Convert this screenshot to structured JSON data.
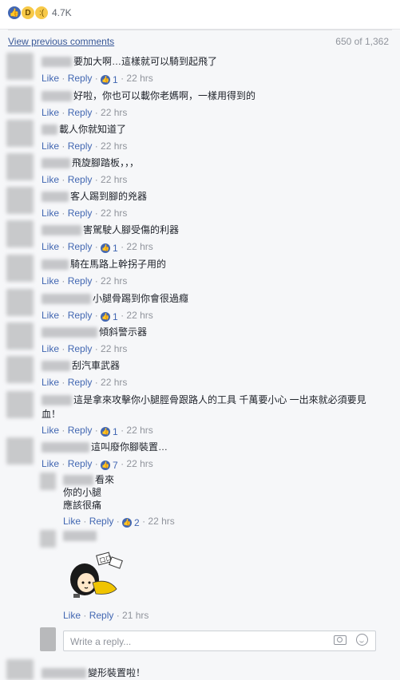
{
  "reactions": {
    "count": "4.7K"
  },
  "comments_header": {
    "view_previous": "View previous comments",
    "counter": "650 of 1,362"
  },
  "actions": {
    "like": "Like",
    "reply": "Reply"
  },
  "comments": [
    {
      "text": "要加大啊…這樣就可以騎到起飛了",
      "likes": "1",
      "time": "22 hrs"
    },
    {
      "text": "好啦，你也可以載你老媽啊，一樣用得到的",
      "likes": "",
      "time": "22 hrs"
    },
    {
      "text": "載人你就知道了",
      "likes": "",
      "time": "22 hrs"
    },
    {
      "text": "飛旋腳踏板，，，",
      "likes": "",
      "time": "22 hrs"
    },
    {
      "text": "客人踢到腳的兇器",
      "likes": "",
      "time": "22 hrs"
    },
    {
      "text": "害駕駛人腳受傷的利器",
      "likes": "1",
      "time": "22 hrs"
    },
    {
      "text": "騎在馬路上幹拐子用的",
      "likes": "",
      "time": "22 hrs"
    },
    {
      "text": "小腿骨踢到你會很過癮",
      "likes": "1",
      "time": "22 hrs"
    },
    {
      "text": "傾斜警示器",
      "likes": "",
      "time": "22 hrs"
    },
    {
      "text": "刮汽車武器",
      "likes": "",
      "time": "22 hrs"
    },
    {
      "text": "這是拿來攻擊你小腿脛骨跟路人的工具 千萬要小心 一出來就必須要見",
      "text2": "血！",
      "likes": "1",
      "time": "22 hrs"
    },
    {
      "text": "這叫廢你腳裝置…",
      "likes": "7",
      "time": "22 hrs"
    }
  ],
  "replies": [
    {
      "line1": "看來",
      "line2": "你的小腿",
      "line3": "應該很痛",
      "likes": "2",
      "time": "22 hrs"
    },
    {
      "time": "21 hrs"
    }
  ],
  "reply_input": {
    "placeholder": "Write a reply..."
  },
  "last_comment": {
    "text": "變形裝置啦！"
  },
  "colors": {
    "link": "#4267b2",
    "meta": "#90949c",
    "bg": "#f6f7f9"
  }
}
